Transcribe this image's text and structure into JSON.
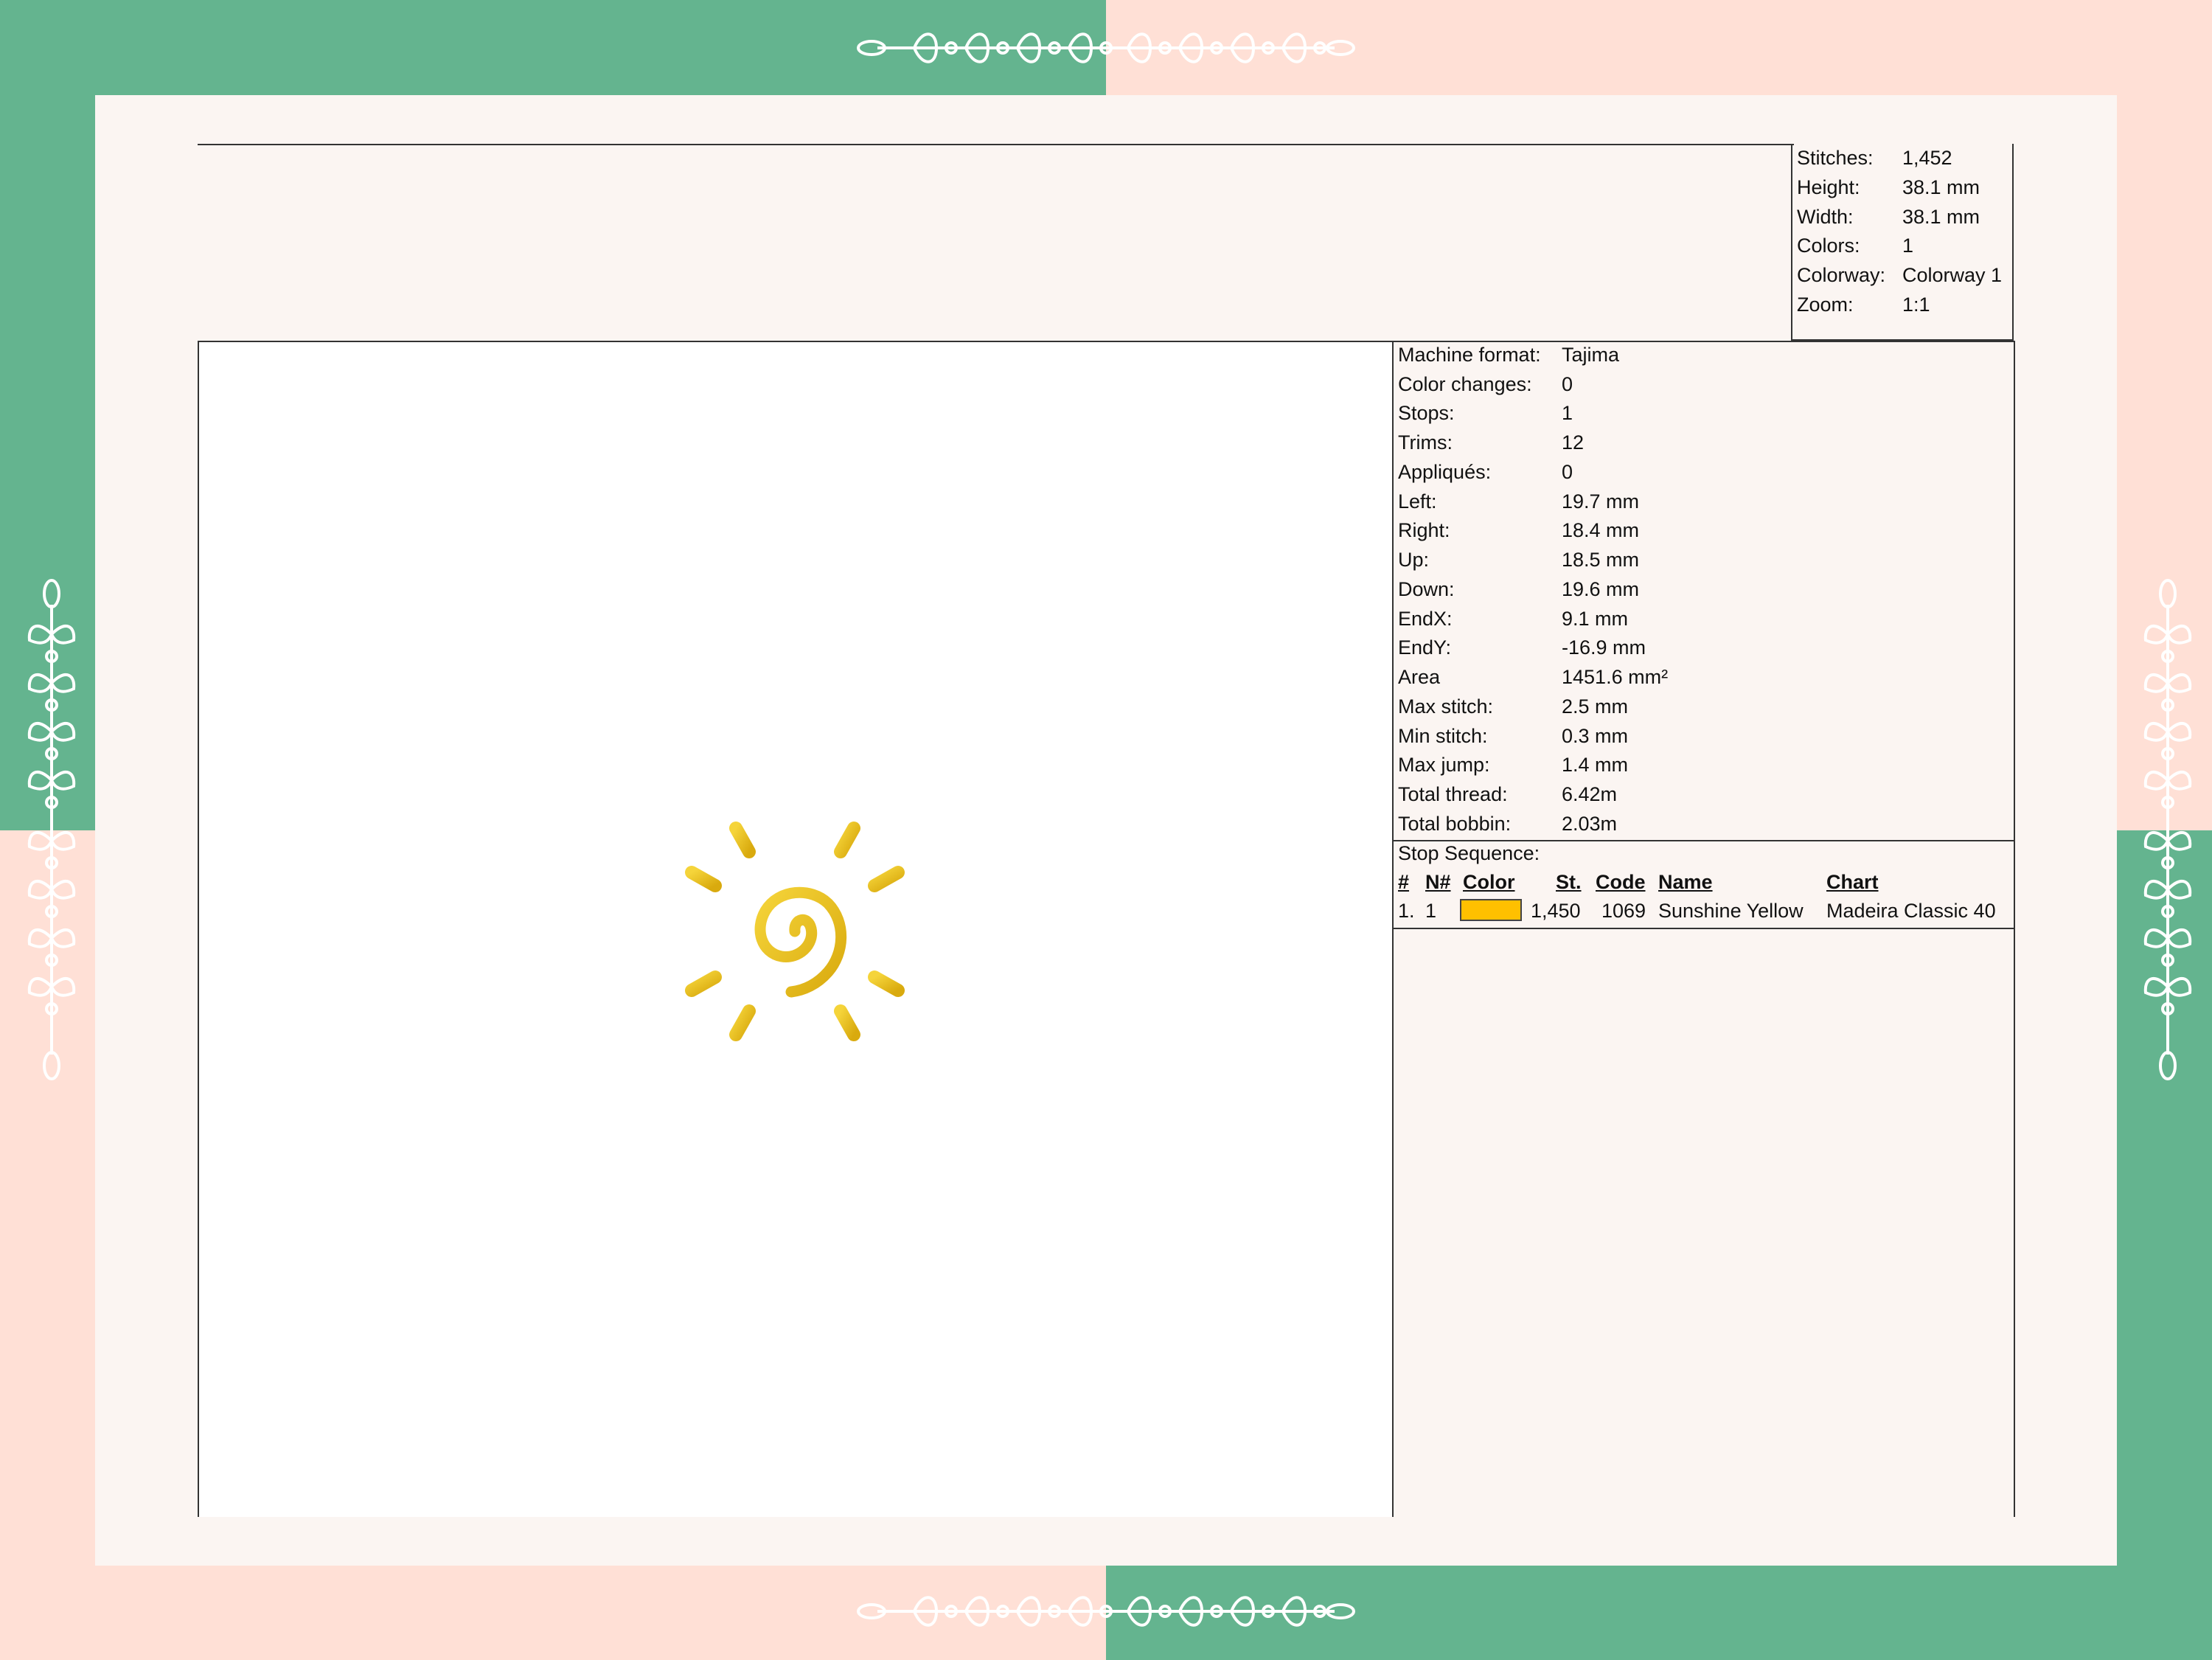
{
  "stats": {
    "stitches_label": "Stitches:",
    "stitches": "1,452",
    "height_label": "Height:",
    "height": "38.1 mm",
    "width_label": "Width:",
    "width": "38.1 mm",
    "colors_label": "Colors:",
    "colors": "1",
    "colorway_label": "Colorway:",
    "colorway": "Colorway 1",
    "zoom_label": "Zoom:",
    "zoom": "1:1"
  },
  "info": [
    {
      "label": "Machine format:",
      "value": "Tajima"
    },
    {
      "label": "Color changes:",
      "value": "0"
    },
    {
      "label": "Stops:",
      "value": "1"
    },
    {
      "label": "Trims:",
      "value": "12"
    },
    {
      "label": "Appliqués:",
      "value": "0"
    },
    {
      "label": "Left:",
      "value": "19.7 mm"
    },
    {
      "label": "Right:",
      "value": "18.4 mm"
    },
    {
      "label": "Up:",
      "value": "18.5 mm"
    },
    {
      "label": "Down:",
      "value": "19.6 mm"
    },
    {
      "label": "EndX:",
      "value": "9.1 mm"
    },
    {
      "label": "EndY:",
      "value": "-16.9 mm"
    },
    {
      "label": "Area",
      "value": "1451.6 mm²"
    },
    {
      "label": "Max stitch:",
      "value": "2.5 mm"
    },
    {
      "label": "Min stitch:",
      "value": "0.3 mm"
    },
    {
      "label": "Max jump:",
      "value": "1.4 mm"
    },
    {
      "label": "Total thread:",
      "value": "6.42m"
    },
    {
      "label": "Total bobbin:",
      "value": "2.03m"
    }
  ],
  "stop_sequence": {
    "title": "Stop Sequence:",
    "headers": {
      "num": "#",
      "n": "N#",
      "color": "Color",
      "st": "St.",
      "code": "Code",
      "name": "Name",
      "chart": "Chart"
    },
    "rows": [
      {
        "num": "1.",
        "n": "1",
        "color": "#ffc000",
        "st": "1,450",
        "code": "1069",
        "name": "Sunshine Yellow",
        "chart": "Madeira Classic 40"
      }
    ]
  },
  "colors": {
    "green": "#64b48f",
    "pink": "#ffe0d6",
    "card": "#fbf5f2",
    "thread": "#e9be1a"
  },
  "icons": [
    "leaf-vine-ornament-icon",
    "sun-embroidery-design"
  ]
}
